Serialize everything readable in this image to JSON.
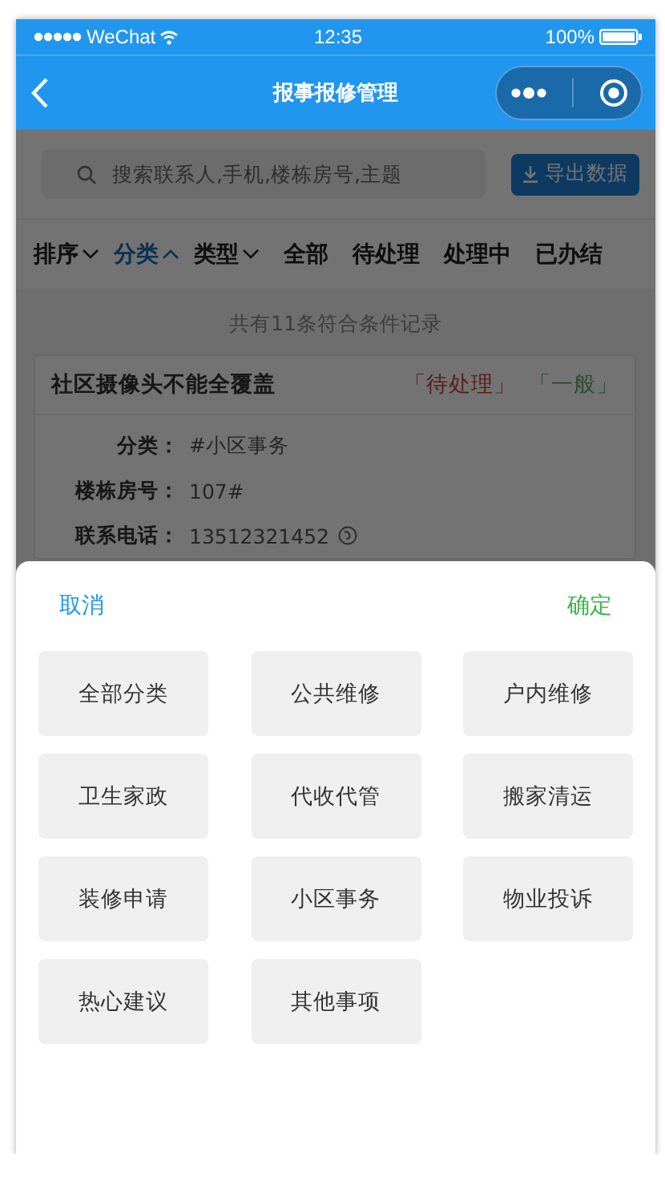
{
  "status_bar": {
    "carrier": "WeChat",
    "time": "12:35",
    "battery": "100%"
  },
  "nav_bar": {
    "title": "报事报修管理"
  },
  "search": {
    "placeholder": "搜索联系人,手机,楼栋房号,主题"
  },
  "export_button": "导出数据",
  "filters": [
    {
      "label": "排序",
      "kind": "dropdown",
      "expanded": false
    },
    {
      "label": "分类",
      "kind": "dropdown",
      "expanded": true
    },
    {
      "label": "类型",
      "kind": "dropdown",
      "expanded": false
    },
    {
      "label": "全部",
      "kind": "tab",
      "selected": false
    },
    {
      "label": "待处理",
      "kind": "tab",
      "selected": false
    },
    {
      "label": "处理中",
      "kind": "tab",
      "selected": false
    },
    {
      "label": "已办结",
      "kind": "tab",
      "selected": false
    }
  ],
  "record_count": "共有11条符合条件记录",
  "record": {
    "title": "社区摄像头不能全覆盖",
    "status": "「待处理」",
    "priority": "「一般」",
    "fields": [
      {
        "label": "分类：",
        "value": "#小区事务"
      },
      {
        "label": "楼栋房号：",
        "value": "107#"
      },
      {
        "label": "联系电话：",
        "value": "13512321452"
      }
    ]
  },
  "sheet": {
    "cancel": "取消",
    "confirm": "确定",
    "options": [
      {
        "label": "全部分类",
        "selected": false
      },
      {
        "label": "公共维修",
        "selected": false
      },
      {
        "label": "户内维修",
        "selected": false
      },
      {
        "label": "卫生家政",
        "selected": false
      },
      {
        "label": "代收代管",
        "selected": false
      },
      {
        "label": "搬家清运",
        "selected": false
      },
      {
        "label": "装修申请",
        "selected": false
      },
      {
        "label": "小区事务",
        "selected": false
      },
      {
        "label": "物业投诉",
        "selected": false
      },
      {
        "label": "热心建议",
        "selected": false
      },
      {
        "label": "其他事项",
        "selected": false
      }
    ]
  }
}
